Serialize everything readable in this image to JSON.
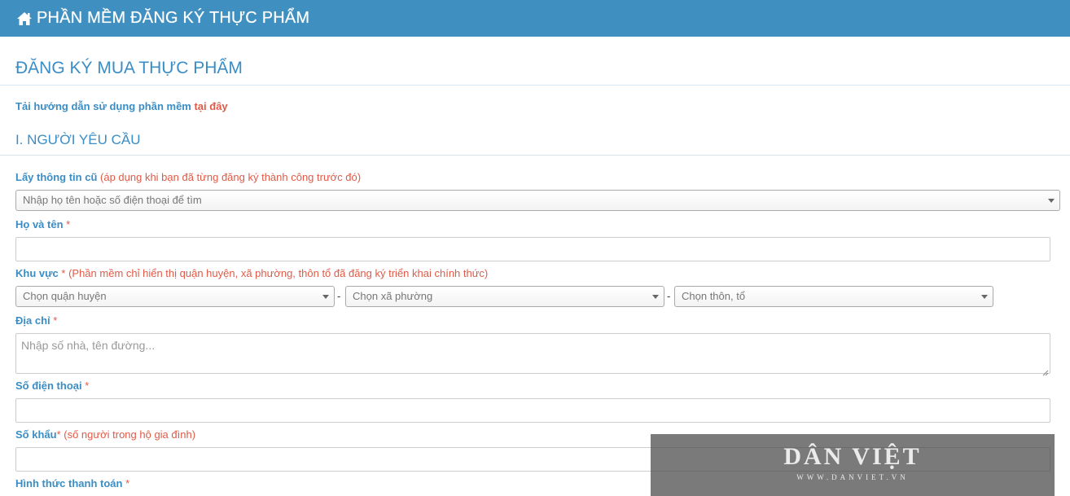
{
  "header": {
    "title": "PHẦN MỀM ĐĂNG KÝ THỰC PHẨM",
    "icon": "home-icon",
    "color": "#3f8fc0"
  },
  "page": {
    "title": "ĐĂNG KÝ MUA THỰC PHẨM",
    "guide_text": "Tải hướng dẫn sử dụng phần mềm ",
    "guide_link": "tại đây"
  },
  "section": {
    "title": "I. NGƯỜI YÊU CẦU"
  },
  "form": {
    "old_info": {
      "label": "Lấy thông tin cũ",
      "note": "(áp dụng khi bạn đã từng đăng ký thành công trước đó)",
      "placeholder": "Nhập họ tên hoặc số điện thoại để tìm"
    },
    "full_name": {
      "label": "Họ và tên",
      "required": "*"
    },
    "area": {
      "label": "Khu vực",
      "required": "*",
      "note": "(Phần mềm chỉ hiển thị quận huyện, xã phường, thôn tổ đã đăng ký triển khai chính thức)",
      "district_placeholder": "Chọn quận huyện",
      "ward_placeholder": "Chọn xã phường",
      "hamlet_placeholder": "Chọn thôn, tổ",
      "separator": "-"
    },
    "address": {
      "label": "Địa chỉ",
      "required": "*",
      "placeholder": "Nhập số nhà, tên đường..."
    },
    "phone": {
      "label": "Số điện thoại",
      "required": "*"
    },
    "household": {
      "label": "Số khẩu",
      "required": "*",
      "note": "(số người trong hộ gia đình)"
    },
    "payment": {
      "label": "Hình thức thanh toán",
      "required": "*"
    }
  },
  "watermark": {
    "title": "DÂN VIỆT",
    "url": "WWW.DANVIET.VN"
  }
}
